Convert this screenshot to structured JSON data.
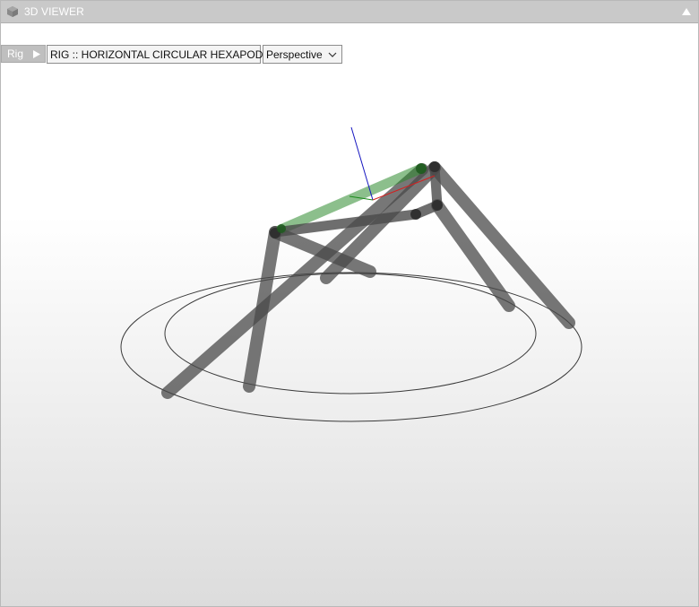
{
  "titlebar": {
    "title": "3D VIEWER",
    "app_icon": "cube-icon",
    "collapse_icon": "triangle-up-icon"
  },
  "toolbar": {
    "rig_label": "Rig",
    "rig_toggle_icon": "play-triangle-icon",
    "rig_selected": "RIG :: HORIZONTAL CIRCULAR HEXAPOD",
    "view_selected": "Perspective"
  },
  "scene": {
    "platform_color": "#2e8b2e",
    "leg_color": "#4a4a4a",
    "axis_x_color": "#d42020",
    "axis_y_color": "#1a8a1a",
    "axis_z_color": "#1515c0"
  }
}
